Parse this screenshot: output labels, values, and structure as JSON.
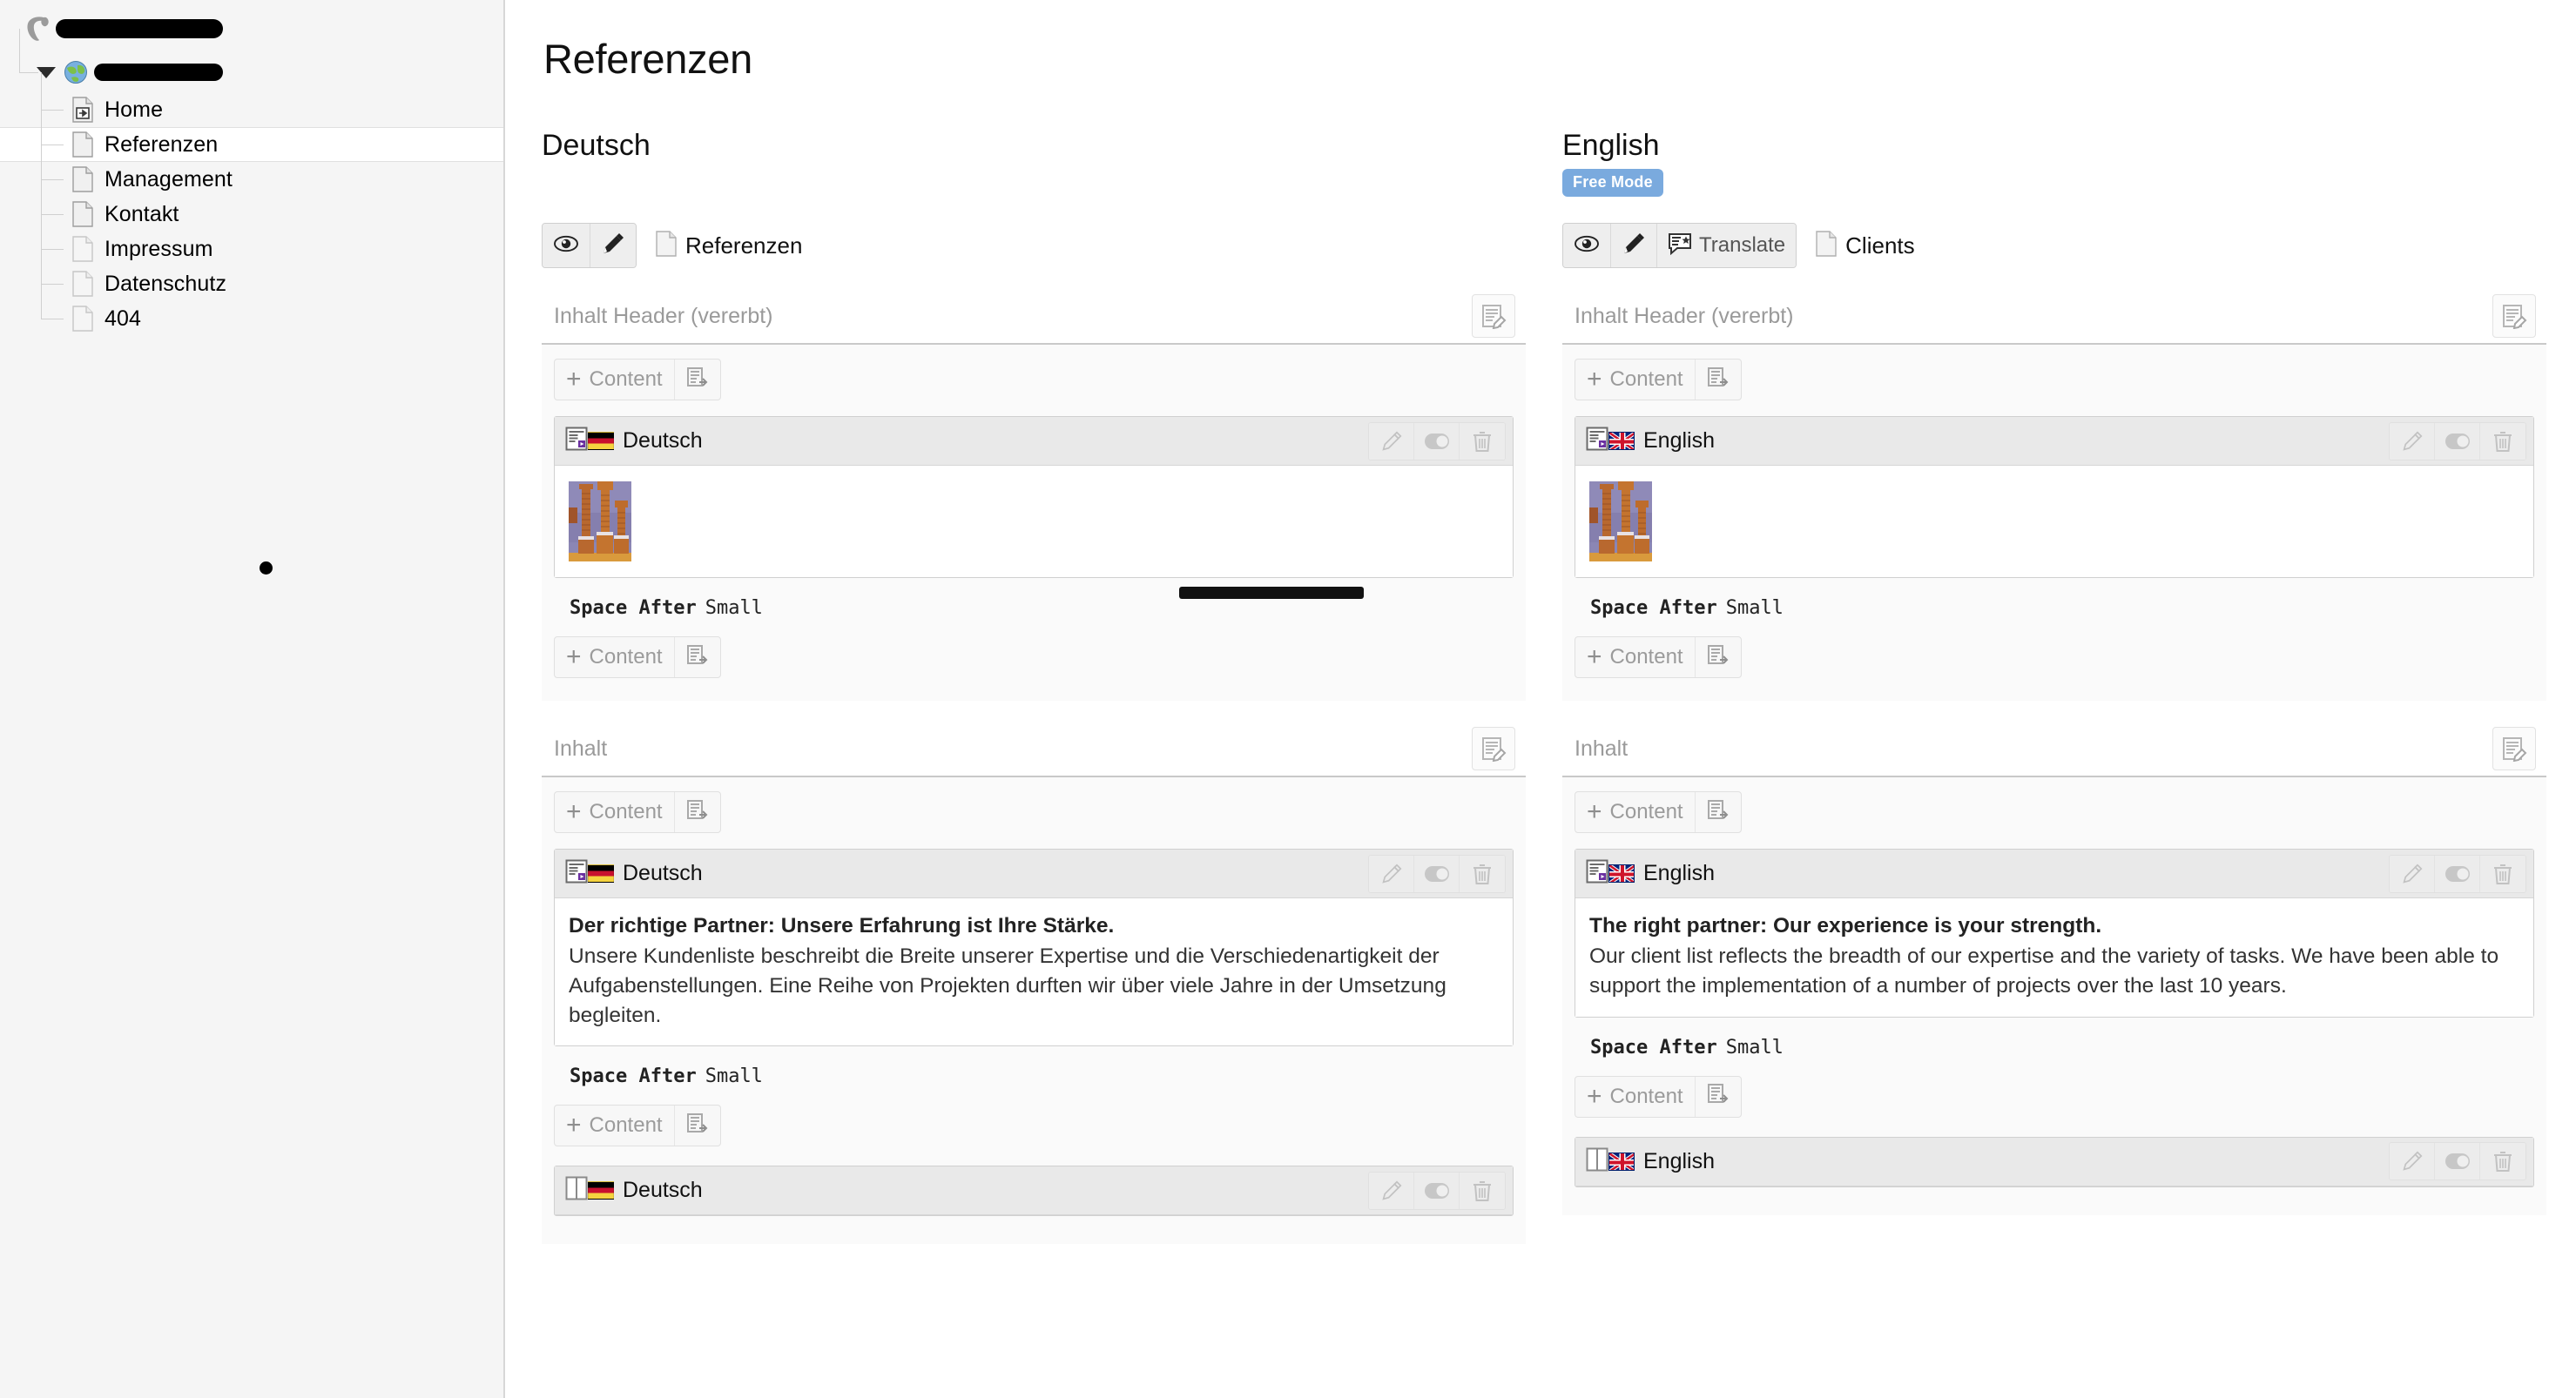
{
  "sidebar": {
    "tree": [
      {
        "label": "",
        "redacted": true,
        "icon": "typo3-logo-icon",
        "depth": 0
      },
      {
        "label": "",
        "redacted": true,
        "icon": "globe-icon",
        "depth": 1,
        "expanded": true
      },
      {
        "label": "Home",
        "icon": "page-shortcut-icon",
        "depth": 2
      },
      {
        "label": "Referenzen",
        "icon": "page-icon",
        "depth": 2,
        "selected": true
      },
      {
        "label": "Management",
        "icon": "page-icon",
        "depth": 2
      },
      {
        "label": "Kontakt",
        "icon": "page-icon",
        "depth": 2
      },
      {
        "label": "Impressum",
        "icon": "page-icon",
        "depth": 2
      },
      {
        "label": "Datenschutz",
        "icon": "page-icon",
        "depth": 2
      },
      {
        "label": "404",
        "icon": "page-icon",
        "depth": 2
      }
    ]
  },
  "main": {
    "page_title": "Referenzen",
    "columns": [
      {
        "language": "Deutsch",
        "badge": "",
        "toolbar": {
          "view_icon": "eye-icon",
          "edit_icon": "pencil-icon",
          "translate_label": "",
          "page_icon": "page-icon",
          "page_label": "Referenzen"
        },
        "sections": [
          {
            "title": "Inhalt Header (vererbt)",
            "edit_icon": "edit-column-icon",
            "add_label": "Content",
            "elements": [
              {
                "type_icon": "content-media-icon",
                "flag": "de",
                "lang_label": "Deutsch",
                "body_kind": "image",
                "headline": "",
                "text": "",
                "space_after_key": "Space After",
                "space_after_value": "Small",
                "redaction": true
              }
            ],
            "add_label_bottom": "Content"
          },
          {
            "title": "Inhalt",
            "edit_icon": "edit-column-icon",
            "add_label": "Content",
            "elements": [
              {
                "type_icon": "content-text-icon",
                "flag": "de",
                "lang_label": "Deutsch",
                "body_kind": "text",
                "headline": "Der richtige Partner: Unsere Erfahrung ist Ihre Stärke.",
                "text": "Unsere Kundenliste beschreibt die Breite unserer Expertise und die Verschiedenartigkeit der Aufgabenstellungen. Eine Reihe von Projekten durften wir über viele Jahre in der Umsetzung begleiten.",
                "space_after_key": "Space After",
                "space_after_value": "Small",
                "redaction": false
              },
              {
                "type_icon": "content-columns-icon",
                "flag": "de",
                "lang_label": "Deutsch",
                "body_kind": "cutoff",
                "headline": "",
                "text": "",
                "space_after_key": "",
                "space_after_value": "",
                "redaction": false
              }
            ],
            "add_label_bottom": "Content"
          }
        ]
      },
      {
        "language": "English",
        "badge": "Free Mode",
        "toolbar": {
          "view_icon": "eye-icon",
          "edit_icon": "pencil-icon",
          "translate_label": "Translate",
          "page_icon": "page-icon",
          "page_label": "Clients"
        },
        "sections": [
          {
            "title": "Inhalt Header (vererbt)",
            "edit_icon": "edit-column-icon",
            "add_label": "Content",
            "elements": [
              {
                "type_icon": "content-media-icon",
                "flag": "gb",
                "lang_label": "English",
                "body_kind": "image",
                "headline": "",
                "text": "",
                "space_after_key": "Space After",
                "space_after_value": "Small",
                "redaction": false
              }
            ],
            "add_label_bottom": "Content"
          },
          {
            "title": "Inhalt",
            "edit_icon": "edit-column-icon",
            "add_label": "Content",
            "elements": [
              {
                "type_icon": "content-text-icon",
                "flag": "gb",
                "lang_label": "English",
                "body_kind": "text",
                "headline": "The right partner: Our experience is your strength.",
                "text": "Our client list reflects the breadth of our expertise and the variety of tasks. We have been able to support the implementation of a number of projects over the last 10 years.",
                "space_after_key": "Space After",
                "space_after_value": "Small",
                "redaction": false
              },
              {
                "type_icon": "content-columns-icon",
                "flag": "gb",
                "lang_label": "English",
                "body_kind": "cutoff",
                "headline": "",
                "text": "",
                "space_after_key": "",
                "space_after_value": "",
                "redaction": false
              }
            ],
            "add_label_bottom": "Content"
          }
        ]
      }
    ]
  },
  "colors": {
    "badge_bg": "#7aaade",
    "section_header_text": "#9a9a9a",
    "ce_header_bg": "#e9e9e9",
    "selected_row_bg": "#ffffff",
    "sidebar_bg": "#f5f5f5"
  }
}
